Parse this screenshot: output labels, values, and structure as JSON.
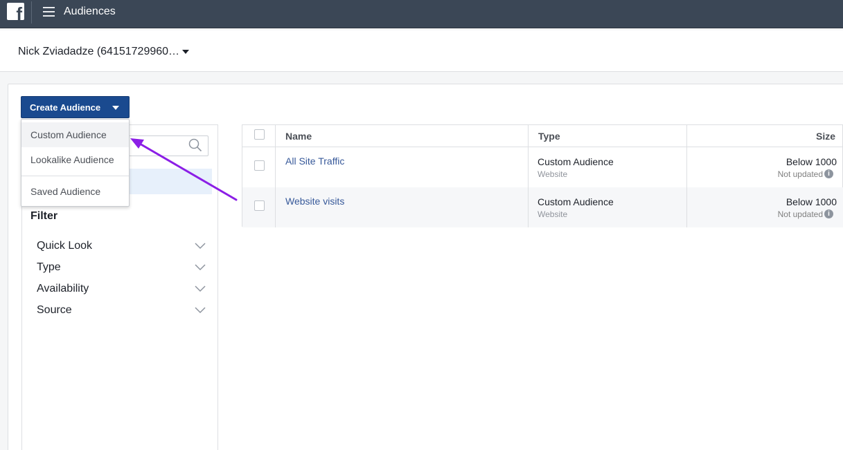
{
  "header": {
    "app_title": "Audiences",
    "logo_icon": "facebook-logo-icon",
    "menu_icon": "hamburger-menu-icon"
  },
  "account": {
    "name": "Nick Zviadadze (64151729960…"
  },
  "toolbar": {
    "create_label": "Create Audience"
  },
  "dropdown": {
    "items": [
      {
        "label": "Custom Audience",
        "active": true
      },
      {
        "label": "Lookalike Audience",
        "active": false
      },
      {
        "label": "Saved Audience",
        "active": false
      }
    ]
  },
  "sidebar": {
    "filter_title": "Filter",
    "filters": [
      {
        "label": "Quick Look"
      },
      {
        "label": "Type"
      },
      {
        "label": "Availability"
      },
      {
        "label": "Source"
      }
    ]
  },
  "table": {
    "columns": [
      "Name",
      "Type",
      "Size"
    ],
    "rows": [
      {
        "name": "All Site Traffic",
        "type": "Custom Audience",
        "source": "Website",
        "size": "Below 1000",
        "updated": "Not updated"
      },
      {
        "name": "Website visits",
        "type": "Custom Audience",
        "source": "Website",
        "size": "Below 1000",
        "updated": "Not updated"
      }
    ]
  },
  "colors": {
    "topbar": "#3b4756",
    "primary_button": "#1a4a8f",
    "link": "#365899",
    "annotation_arrow": "#8b1ee6"
  }
}
